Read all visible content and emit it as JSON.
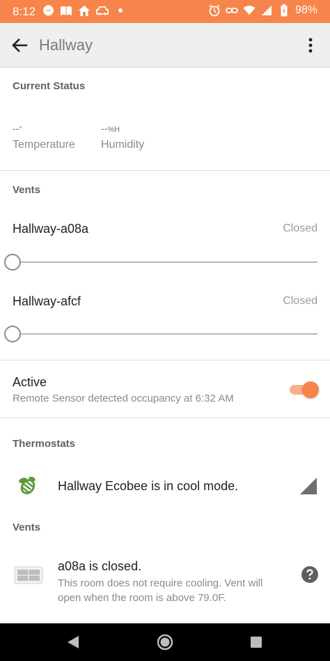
{
  "status_bar": {
    "time": "8:12",
    "battery_pct": "98%",
    "left_icons": [
      "messenger-icon",
      "book-icon",
      "home-icon",
      "car-icon",
      "dot-icon"
    ],
    "right_icons": [
      "alarm-icon",
      "link-icon",
      "wifi-icon",
      "signal-icon",
      "battery-icon"
    ]
  },
  "app_bar": {
    "title": "Hallway"
  },
  "current_status": {
    "heading": "Current Status",
    "temperature": {
      "value": "--",
      "unit": "°",
      "label": "Temperature"
    },
    "humidity": {
      "value": "--",
      "unit": "%H",
      "label": "Humidity"
    }
  },
  "vents_section": {
    "heading": "Vents",
    "items": [
      {
        "name": "Hallway-a08a",
        "state": "Closed",
        "level": 0
      },
      {
        "name": "Hallway-afcf",
        "state": "Closed",
        "level": 0
      }
    ]
  },
  "active": {
    "title": "Active",
    "subtitle": "Remote Sensor detected occupancy at 6:32 AM",
    "enabled": true
  },
  "thermostats": {
    "heading": "Thermostats",
    "item_text": "Hallway Ecobee is in cool mode."
  },
  "vents_status": {
    "heading": "Vents",
    "item_title": "a08a is closed.",
    "item_sub": "This room does not require cooling. Vent will open when the room is above 79.0F."
  },
  "colors": {
    "accent": "#f7854b",
    "appbar": "#efefef",
    "bee": "#5a9a3a"
  }
}
